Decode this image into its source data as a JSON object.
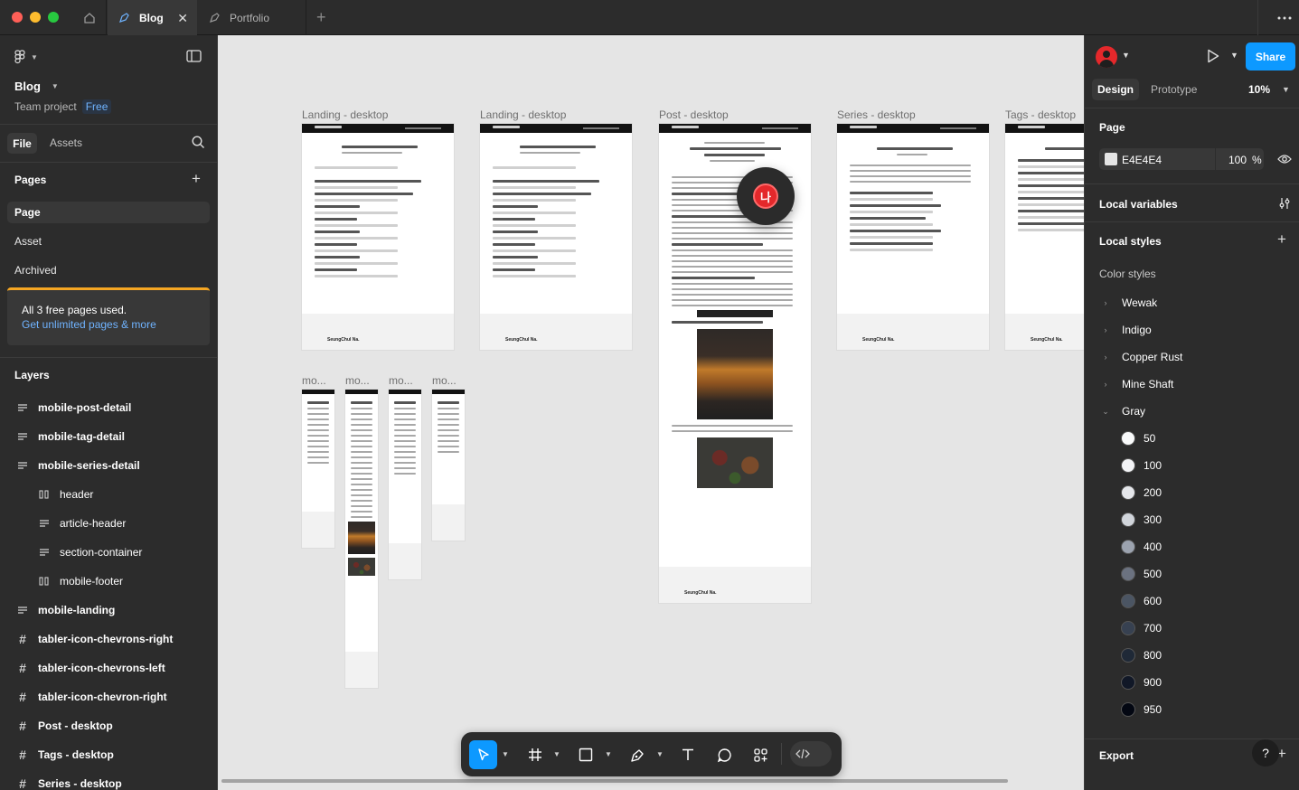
{
  "tabs": [
    {
      "label": "Blog"
    },
    {
      "label": "Portfolio"
    }
  ],
  "sidebar": {
    "project_name": "Blog",
    "team_label": "Team project",
    "plan_badge": "Free",
    "file_tab": "File",
    "assets_tab": "Assets",
    "pages_title": "Pages",
    "pages": [
      {
        "label": "Page"
      },
      {
        "label": "Asset"
      },
      {
        "label": "Archived"
      }
    ],
    "upgrade_text": "All 3 free pages used.",
    "upgrade_link": "Get unlimited pages & more",
    "layers_title": "Layers",
    "layers": [
      {
        "label": "mobile-post-detail"
      },
      {
        "label": "mobile-tag-detail"
      },
      {
        "label": "mobile-series-detail"
      },
      {
        "label": "header"
      },
      {
        "label": "article-header"
      },
      {
        "label": "section-container"
      },
      {
        "label": "mobile-footer"
      },
      {
        "label": "mobile-landing"
      },
      {
        "label": "tabler-icon-chevrons-right"
      },
      {
        "label": "tabler-icon-chevrons-left"
      },
      {
        "label": "tabler-icon-chevron-right"
      },
      {
        "label": "Post - desktop"
      },
      {
        "label": "Tags - desktop"
      },
      {
        "label": "Series - desktop"
      }
    ]
  },
  "canvas": {
    "frame_labels": {
      "landing1": "Landing - desktop",
      "landing2": "Landing - desktop",
      "post": "Post - desktop",
      "series": "Series - desktop",
      "tags": "Tags - desktop",
      "mob1": "mo...",
      "mob2": "mo...",
      "mob3": "mo...",
      "mob4": "mo..."
    },
    "cursor_avatar": "나"
  },
  "right": {
    "share_label": "Share",
    "design_tab": "Design",
    "prototype_tab": "Prototype",
    "zoom": "10%",
    "page_title": "Page",
    "page_color": "E4E4E4",
    "page_opacity": "100",
    "page_opacity_unit": "%",
    "local_variables": "Local variables",
    "local_styles": "Local styles",
    "color_styles": "Color styles",
    "style_groups": [
      {
        "label": "Wewak"
      },
      {
        "label": "Indigo"
      },
      {
        "label": "Copper Rust"
      },
      {
        "label": "Mine Shaft"
      },
      {
        "label": "Gray"
      }
    ],
    "gray_shades": [
      {
        "label": "50",
        "color": "#f9fafb"
      },
      {
        "label": "100",
        "color": "#f3f4f6"
      },
      {
        "label": "200",
        "color": "#e5e7eb"
      },
      {
        "label": "300",
        "color": "#d1d5db"
      },
      {
        "label": "400",
        "color": "#9ca3af"
      },
      {
        "label": "500",
        "color": "#6b7280"
      },
      {
        "label": "600",
        "color": "#4b5563"
      },
      {
        "label": "700",
        "color": "#374151"
      },
      {
        "label": "800",
        "color": "#1f2937"
      },
      {
        "label": "900",
        "color": "#111827"
      },
      {
        "label": "950",
        "color": "#030712"
      }
    ],
    "export_title": "Export",
    "help": "?"
  },
  "colors": {
    "accent": "#0d99ff",
    "upgrade_bar": "#f5a623",
    "canvas_bg": "#e5e5e5"
  }
}
